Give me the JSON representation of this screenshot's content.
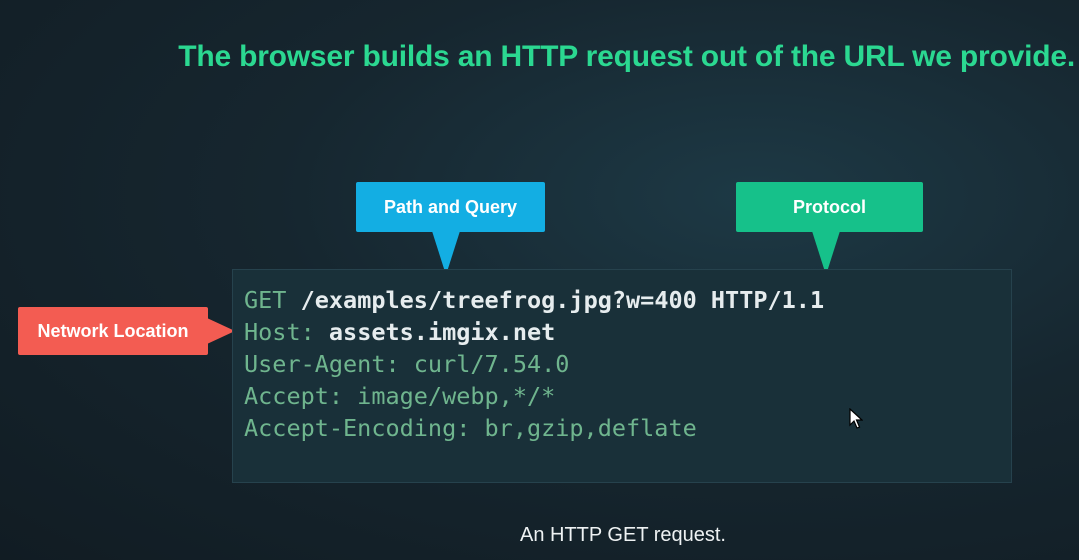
{
  "slide": {
    "title": "The browser builds an HTTP request out of the URL we provide.",
    "caption": "An HTTP GET request."
  },
  "callouts": {
    "path_and_query": "Path and Query",
    "protocol": "Protocol",
    "network_location": "Network Location"
  },
  "request": {
    "method": "GET",
    "target": "/examples/treefrog.jpg?w=400 HTTP/1.1",
    "host_key": "Host:",
    "host_value": "assets.imgix.net",
    "user_agent": "User-Agent: curl/7.54.0",
    "accept": "Accept: image/webp,*/*",
    "accept_encoding": "Accept-Encoding: br,gzip,deflate"
  },
  "colors": {
    "title": "#2bd891",
    "path_callout": "#13aee3",
    "protocol_callout": "#16c18a",
    "network_callout": "#f35c52"
  },
  "icons": {
    "cursor": "mouse-pointer-icon"
  }
}
